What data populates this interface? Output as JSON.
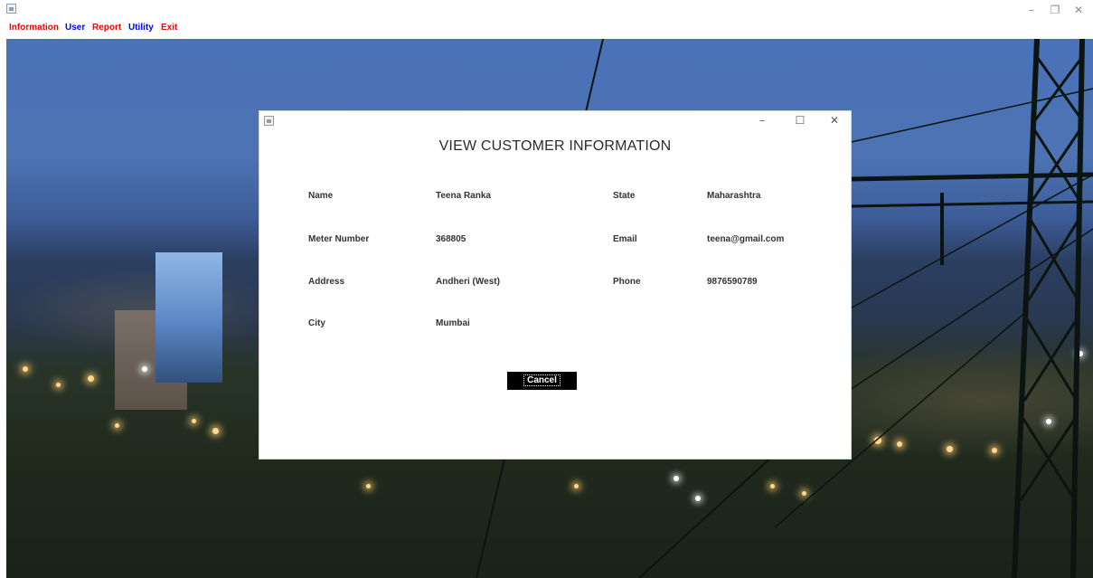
{
  "window": {
    "controls": {
      "minimize": "–",
      "maximize": "❐",
      "close": "✕"
    }
  },
  "menu": [
    {
      "label": "Information",
      "color": "#ff0000"
    },
    {
      "label": "User",
      "color": "#0000ff"
    },
    {
      "label": "Report",
      "color": "#ff0000"
    },
    {
      "label": "Utility",
      "color": "#0000ff"
    },
    {
      "label": "Exit",
      "color": "#ff0000"
    }
  ],
  "dialog": {
    "title": "VIEW CUSTOMER INFORMATION",
    "controls": {
      "minimize": "–",
      "maximize": "☐",
      "close": "✕"
    },
    "fields": {
      "name": {
        "label": "Name",
        "value": "Teena Ranka"
      },
      "meter_number": {
        "label": "Meter Number",
        "value": "368805"
      },
      "address": {
        "label": "Address",
        "value": "Andheri (West)"
      },
      "city": {
        "label": "City",
        "value": "Mumbai"
      },
      "state": {
        "label": "State",
        "value": "Maharashtra"
      },
      "email": {
        "label": "Email",
        "value": "teena@gmail.com"
      },
      "phone": {
        "label": "Phone",
        "value": "9876590789"
      }
    },
    "cancel_label": "Cancel"
  },
  "colors": {
    "menu_red": "#ff0000",
    "menu_blue": "#0000ff",
    "button_bg": "#000000",
    "button_text": "#ffffff"
  }
}
